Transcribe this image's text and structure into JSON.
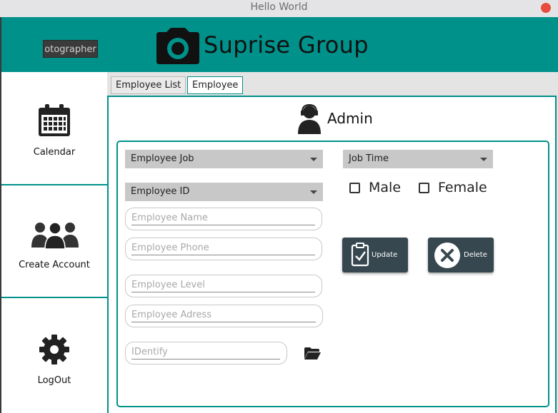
{
  "window": {
    "title": "Hello World"
  },
  "header": {
    "photographer_button": "otographer",
    "brand_name": "Suprise Group"
  },
  "sidebar": {
    "items": [
      {
        "label": "Calendar",
        "icon": "calendar-icon"
      },
      {
        "label": "Create Account",
        "icon": "group-icon"
      },
      {
        "label": "LogOut",
        "icon": "gear-icon"
      }
    ]
  },
  "tabs": [
    {
      "label": "Employee List",
      "active": false
    },
    {
      "label": "Employee",
      "active": true
    }
  ],
  "panel": {
    "heading": "Admin"
  },
  "form": {
    "employee_job": {
      "selected": "Employee Job"
    },
    "employee_id": {
      "selected": "Employee ID"
    },
    "job_time": {
      "selected": "Job Time"
    },
    "name": {
      "placeholder": "Employee Name"
    },
    "phone": {
      "placeholder": "Employee Phone"
    },
    "level": {
      "placeholder": "Employee Level"
    },
    "address": {
      "placeholder": "Employee Adress"
    },
    "identify": {
      "placeholder": "IDentify"
    },
    "gender": {
      "male": "Male",
      "female": "Female"
    },
    "update_label": "Update",
    "delete_label": "Delete"
  },
  "colors": {
    "accent": "#00918a",
    "button_dark": "#37474f",
    "combo_bg": "#c8c8c8"
  }
}
